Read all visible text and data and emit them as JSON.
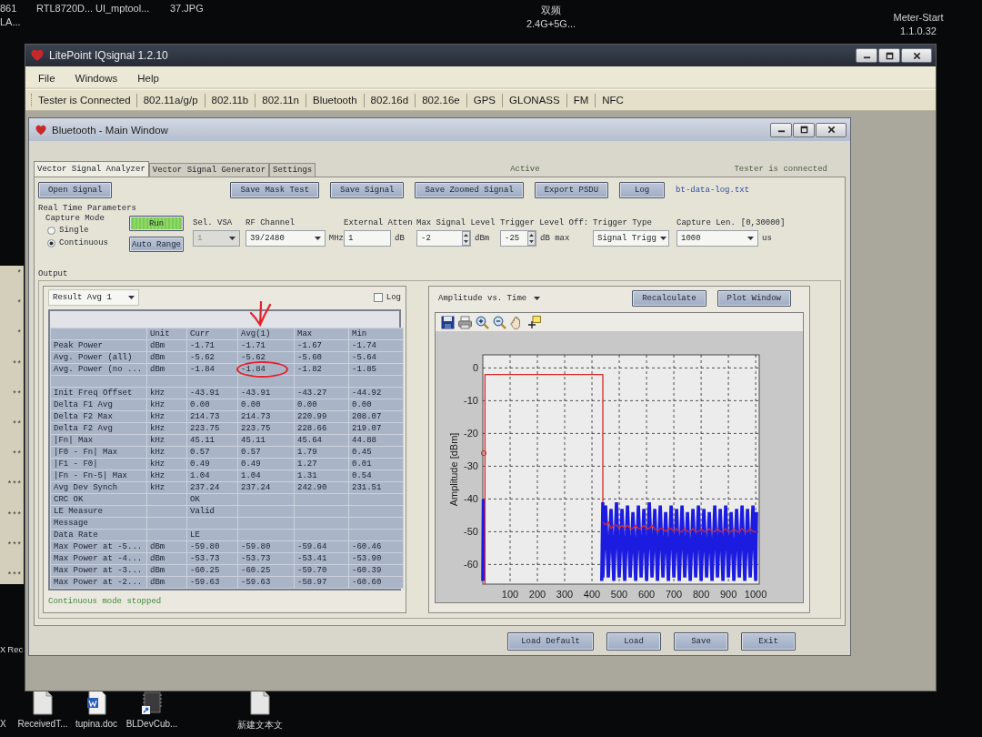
{
  "desktop": {
    "top_icons": [
      {
        "lines": [
          "861",
          "LA..."
        ]
      },
      {
        "lines": [
          "RTL8720D..."
        ]
      },
      {
        "lines": [
          "UI_mptool..."
        ]
      },
      {
        "lines": [
          "37.JPG"
        ]
      },
      {
        "lines": [
          "双频",
          "2.4G+5G..."
        ]
      },
      {
        "lines": [
          "Meter-Start",
          "1.1.0.32"
        ]
      }
    ],
    "background_window": {
      "lines": [
        "*",
        "*",
        "*",
        "**",
        "**",
        "**",
        "**",
        "***",
        "***",
        "***",
        "***"
      ]
    },
    "side_labels": [
      "X",
      "Rec"
    ],
    "bottom_icons": [
      {
        "kind": "none",
        "label": "X"
      },
      {
        "kind": "file",
        "label": "ReceivedT..."
      },
      {
        "kind": "document",
        "label": "tupina.doc"
      },
      {
        "kind": "shortcut",
        "label": "BLDevCub..."
      },
      {
        "kind": "file",
        "label": "新建文本文"
      }
    ]
  },
  "app_window": {
    "title": "LitePoint IQsignal 1.2.10",
    "menu": [
      "File",
      "Windows",
      "Help"
    ],
    "toolbar": {
      "status": "Tester is Connected",
      "items": [
        "802.11a/g/p",
        "802.11b",
        "802.11n",
        "Bluetooth",
        "802.16d",
        "802.16e",
        "GPS",
        "GLONASS",
        "FM",
        "NFC"
      ]
    },
    "child_window": {
      "title": "Bluetooth - Main Window",
      "tabs": [
        {
          "label": "Vector Signal Analyzer",
          "selected": true
        },
        {
          "label": "Vector Signal Generator",
          "selected": false
        },
        {
          "label": "Settings",
          "selected": false
        }
      ],
      "status": "Active",
      "connection": "Tester is connected",
      "actions": [
        "Open Signal",
        "Save Mask Test",
        "Save Signal",
        "Save Zoomed Signal",
        "Export PSDU",
        "Log"
      ],
      "log_file": "bt-data-log.txt",
      "real_time": {
        "title": "Real Time Parameters",
        "capture_mode": {
          "label": "Capture Mode",
          "options": [
            {
              "label": "Single",
              "selected": false
            },
            {
              "label": "Continuous",
              "selected": true
            }
          ]
        },
        "run_button": {
          "label": "Run",
          "active": true
        },
        "auto_range_button": "Auto Range",
        "fields": [
          {
            "kind": "dropdown",
            "label": "Sel. VSA",
            "value": "1",
            "disabled": true
          },
          {
            "kind": "dropdown",
            "label": "RF Channel",
            "value": "39/2480",
            "unit": "MHz",
            "disabled": false
          },
          {
            "kind": "input",
            "label": "External Atten",
            "value": "1",
            "unit": "dB",
            "disabled": false
          },
          {
            "kind": "spin",
            "label": "Max Signal Level",
            "value": "-2",
            "unit": "dBm",
            "disabled": false
          },
          {
            "kind": "spin",
            "label": "Trigger Level Off:",
            "value": "-25",
            "unit": "dB max",
            "disabled": false
          },
          {
            "kind": "dropdown",
            "label": "Trigger Type",
            "value": "Signal Trigg",
            "disabled": false
          },
          {
            "kind": "dropdown",
            "label": "Capture Len.",
            "range": "[0,30000]",
            "value": "1000",
            "unit": "us",
            "disabled": false
          }
        ]
      },
      "output": {
        "title": "Output",
        "result_select": "Result Avg 1",
        "log_checkbox": {
          "label": "Log",
          "checked": false
        },
        "table": {
          "columns": [
            {
              "label": "Unit",
              "marked": false
            },
            {
              "label": "Curr",
              "marked": false
            },
            {
              "label": "Avg(1)",
              "marked": true
            },
            {
              "label": "Max",
              "marked": false
            },
            {
              "label": "Min",
              "marked": false
            }
          ],
          "row_groups": [
            {
              "rows": [
                {
                  "name": "Peak Power",
                  "cells": [
                    "dBm",
                    "-1.71",
                    "-1.71",
                    "-1.67",
                    "-1.74"
                  ],
                  "circled": false
                },
                {
                  "name": "Avg. Power (all)",
                  "cells": [
                    "dBm",
                    "-5.62",
                    "-5.62",
                    "-5.60",
                    "-5.64"
                  ],
                  "circled": false
                },
                {
                  "name": "Avg. Power (no ...",
                  "cells": [
                    "dBm",
                    "-1.84",
                    "-1.84",
                    "-1.82",
                    "-1.85"
                  ],
                  "circled": true
                }
              ]
            },
            {
              "rows": [
                {
                  "name": "Init Freq Offset",
                  "cells": [
                    "kHz",
                    "-43.91",
                    "-43.91",
                    "-43.27",
                    "-44.92"
                  ],
                  "circled": false
                },
                {
                  "name": "Delta F1 Avg",
                  "cells": [
                    "kHz",
                    "0.00",
                    "0.00",
                    "0.00",
                    "0.00"
                  ],
                  "circled": false
                },
                {
                  "name": "Delta F2 Max",
                  "cells": [
                    "kHz",
                    "214.73",
                    "214.73",
                    "220.99",
                    "208.07"
                  ],
                  "circled": false
                },
                {
                  "name": "Delta F2 Avg",
                  "cells": [
                    "kHz",
                    "223.75",
                    "223.75",
                    "228.66",
                    "219.07"
                  ],
                  "circled": false
                },
                {
                  "name": "|Fn| Max",
                  "cells": [
                    "kHz",
                    "45.11",
                    "45.11",
                    "45.64",
                    "44.88"
                  ],
                  "circled": false
                },
                {
                  "name": "|F0 - Fn| Max",
                  "cells": [
                    "kHz",
                    "0.57",
                    "0.57",
                    "1.79",
                    "0.45"
                  ],
                  "circled": false
                },
                {
                  "name": "|F1 - F0|",
                  "cells": [
                    "kHz",
                    "0.49",
                    "0.49",
                    "1.27",
                    "0.01"
                  ],
                  "circled": false
                },
                {
                  "name": "|Fn - Fn-5| Max",
                  "cells": [
                    "kHz",
                    "1.04",
                    "1.04",
                    "1.31",
                    "0.54"
                  ],
                  "circled": false
                },
                {
                  "name": "Avg Dev Synch",
                  "cells": [
                    "kHz",
                    "237.24",
                    "237.24",
                    "242.90",
                    "231.51"
                  ],
                  "circled": false
                },
                {
                  "name": "CRC OK",
                  "cells": [
                    null,
                    "OK"
                  ],
                  "circled": false
                },
                {
                  "name": "LE Measure",
                  "cells": [
                    null,
                    "Valid"
                  ],
                  "circled": false
                },
                {
                  "name": "Message",
                  "cells": [
                    null
                  ],
                  "circled": false
                },
                {
                  "name": "Data Rate",
                  "cells": [
                    null,
                    "LE"
                  ],
                  "circled": false
                },
                {
                  "name": "Max Power at -5...",
                  "cells": [
                    "dBm",
                    "-59.80",
                    "-59.80",
                    "-59.64",
                    "-60.46"
                  ],
                  "circled": false
                },
                {
                  "name": "Max Power at -4...",
                  "cells": [
                    "dBm",
                    "-53.73",
                    "-53.73",
                    "-53.41",
                    "-53.90"
                  ],
                  "circled": false
                },
                {
                  "name": "Max Power at -3...",
                  "cells": [
                    "dBm",
                    "-60.25",
                    "-60.25",
                    "-59.70",
                    "-60.39"
                  ],
                  "circled": false
                },
                {
                  "name": "Max Power at -2...",
                  "cells": [
                    "dBm",
                    "-59.63",
                    "-59.63",
                    "-58.97",
                    "-60.60"
                  ],
                  "circled": false
                }
              ]
            }
          ]
        },
        "status": "Continuous mode stopped",
        "plot": {
          "view_select": "Amplitude vs. Time",
          "buttons": [
            "Recalculate",
            "Plot Window"
          ],
          "chart_data": {
            "type": "line",
            "ylabel": "Amplitude [dBm]",
            "grid": true,
            "xlim": [
              0,
              1013
            ],
            "ylim": [
              -66,
              4
            ],
            "xticks": [
              100,
              200,
              300,
              400,
              500,
              600,
              700,
              800,
              900,
              1000
            ],
            "yticks": [
              0,
              -10,
              -20,
              -30,
              -40,
              -50,
              -60
            ],
            "x": [
              0,
              2,
              4,
              8,
              8,
              436,
              440,
              440,
              450,
              460,
              470,
              480,
              490,
              500,
              510,
              520,
              530,
              540,
              550,
              560,
              570,
              580,
              590,
              600,
              610,
              620,
              630,
              640,
              650,
              660,
              670,
              680,
              690,
              700,
              710,
              720,
              730,
              740,
              750,
              760,
              770,
              780,
              790,
              800,
              810,
              820,
              830,
              840,
              850,
              860,
              870,
              880,
              890,
              900,
              910,
              920,
              930,
              940,
              950,
              960,
              970,
              980,
              990,
              1000,
              1003
            ],
            "series": [
              {
                "color": "#1c1ce0",
                "values": [
                  -65,
                  -40,
                  -65,
                  null,
                  null,
                  -65,
                  -41,
                  -64,
                  -42,
                  -64,
                  -43,
                  -65,
                  -41,
                  -64,
                  -43,
                  -65,
                  -42,
                  -64,
                  -44,
                  -65,
                  -42,
                  -64,
                  -43,
                  -65,
                  -41,
                  -64,
                  -43,
                  -65,
                  -42,
                  -64,
                  -44,
                  -65,
                  -42,
                  -64,
                  -43,
                  -65,
                  -42,
                  -64,
                  -44,
                  -65,
                  -43,
                  -64,
                  -42,
                  -65,
                  -43,
                  -64,
                  -44,
                  -65,
                  -42,
                  -64,
                  -43,
                  -65,
                  -42,
                  -64,
                  -44,
                  -65,
                  -43,
                  -64,
                  -42,
                  -65,
                  -43,
                  -64,
                  -42,
                  -65,
                  -44
                ]
              },
              {
                "color": "#d42a2a",
                "values": [
                  null,
                  null,
                  null,
                  -66,
                  -2,
                  -2,
                  -2,
                  -41,
                  null,
                  null,
                  null,
                  null,
                  null,
                  null,
                  null,
                  null,
                  null,
                  null,
                  null,
                  null,
                  null,
                  null,
                  null,
                  null,
                  null,
                  null,
                  null,
                  null,
                  null,
                  null,
                  null,
                  null,
                  null,
                  null,
                  null,
                  null,
                  null,
                  null,
                  null,
                  null,
                  null,
                  null,
                  null,
                  null,
                  null,
                  null,
                  null,
                  null,
                  null,
                  null,
                  null,
                  null,
                  null,
                  null,
                  null,
                  null,
                  null,
                  null,
                  null,
                  null,
                  null,
                  null,
                  null,
                  null,
                  null
                ]
              },
              {
                "color": "#d42a2a",
                "values": [
                  null,
                  null,
                  null,
                  null,
                  null,
                  null,
                  -47,
                  -47,
                  -48,
                  -47,
                  -49,
                  -48,
                  -48,
                  -49,
                  -48,
                  -49,
                  -48,
                  -49,
                  -49,
                  -48,
                  -49,
                  -49,
                  -48,
                  -49,
                  -49,
                  -48,
                  -49,
                  -50,
                  -49,
                  -49,
                  -50,
                  -49,
                  -49,
                  -50,
                  -49,
                  -50,
                  -50,
                  -49,
                  -50,
                  -50,
                  -49,
                  -50,
                  -50,
                  -49,
                  -50,
                  -50,
                  -49,
                  -50,
                  -50,
                  -49,
                  -50,
                  -50,
                  -49,
                  -50,
                  -50,
                  -49,
                  -50,
                  -50,
                  -49,
                  -50,
                  -50,
                  -49,
                  -50,
                  -50,
                  -50
                ]
              }
            ]
          }
        }
      },
      "footer_buttons": [
        "Load Default",
        "Load",
        "Save",
        "Exit"
      ]
    }
  }
}
